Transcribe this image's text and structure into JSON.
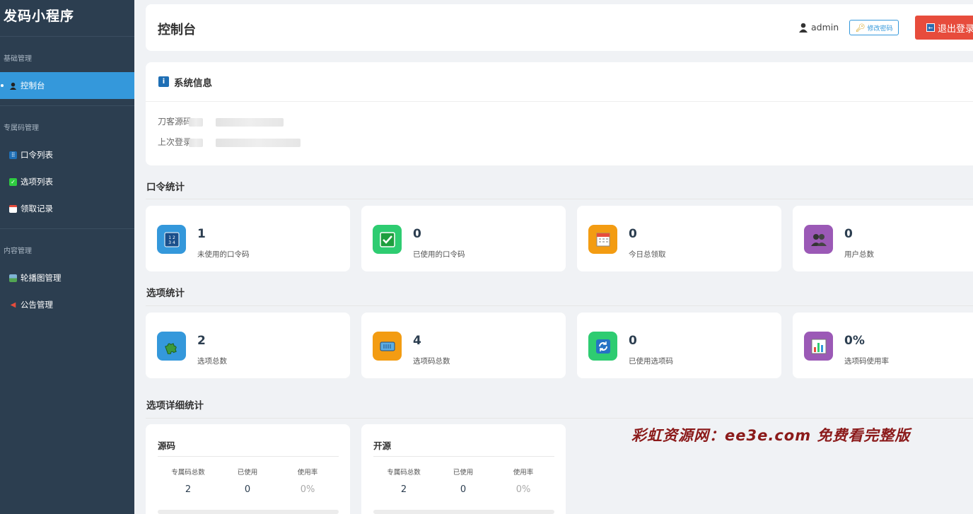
{
  "sidebar": {
    "brand": "发码小程序",
    "groups": [
      {
        "title": "基础管理",
        "items": [
          {
            "label": "控制台",
            "icon": "user-icon",
            "active": true
          }
        ]
      },
      {
        "title": "专属码管理",
        "items": [
          {
            "label": "口令列表",
            "icon": "numbers-icon"
          },
          {
            "label": "选项列表",
            "icon": "check-icon"
          },
          {
            "label": "领取记录",
            "icon": "calendar-icon"
          }
        ]
      },
      {
        "title": "内容管理",
        "items": [
          {
            "label": "轮播图管理",
            "icon": "image-icon"
          },
          {
            "label": "公告管理",
            "icon": "megaphone-icon"
          }
        ]
      }
    ]
  },
  "header": {
    "title": "控制台",
    "username": "admin",
    "change_password": "修改密码",
    "logout": "退出登录"
  },
  "system_info": {
    "title": "系统信息",
    "rows": [
      {
        "label": "刀客源码"
      },
      {
        "label": "上次登录"
      }
    ]
  },
  "code_stats": {
    "title": "口令统计",
    "cards": [
      {
        "value": "1",
        "label": "未使用的口令码",
        "icon": "numbers-icon",
        "color": "#3498db"
      },
      {
        "value": "0",
        "label": "已使用的口令码",
        "icon": "check-icon",
        "color": "#2ecc71"
      },
      {
        "value": "0",
        "label": "今日总领取",
        "icon": "calendar-icon",
        "color": "#f39c12"
      },
      {
        "value": "0",
        "label": "用户总数",
        "icon": "users-icon",
        "color": "#9b59b6"
      }
    ]
  },
  "option_stats": {
    "title": "选项统计",
    "cards": [
      {
        "value": "2",
        "label": "选项总数",
        "icon": "puzzle-icon",
        "color": "#3498db"
      },
      {
        "value": "4",
        "label": "选项码总数",
        "icon": "ticket-icon",
        "color": "#f39c12"
      },
      {
        "value": "0",
        "label": "已使用选项码",
        "icon": "refresh-icon",
        "color": "#2ecc71"
      },
      {
        "value": "0%",
        "label": "选项码使用率",
        "icon": "bar-chart-icon",
        "color": "#9b59b6"
      }
    ]
  },
  "option_details": {
    "title": "选项详细统计",
    "columns": [
      "专属码总数",
      "已使用",
      "使用率"
    ],
    "cards": [
      {
        "name": "源码",
        "total": "2",
        "used": "0",
        "rate": "0%",
        "rate_fraction": 0
      },
      {
        "name": "开源",
        "total": "2",
        "used": "0",
        "rate": "0%",
        "rate_fraction": 0
      }
    ]
  },
  "watermark": "彩虹资源网：ee3e.com 免费看完整版",
  "colors": {
    "sidebar_bg": "#2c3e50",
    "active": "#3498db",
    "logout": "#e74c3c"
  }
}
